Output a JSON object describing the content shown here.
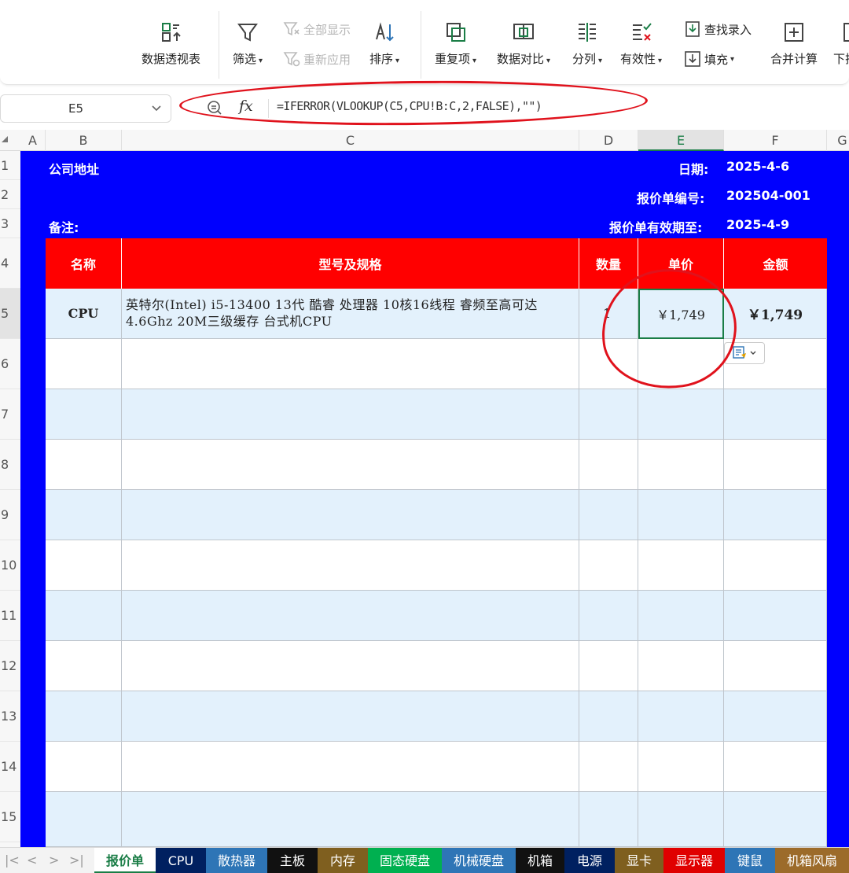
{
  "ribbon": {
    "pivot": "数据透视表",
    "filter": "筛选",
    "show_all": "全部显示",
    "reapply": "重新应用",
    "sort": "排序",
    "duplicates": "重复项",
    "compare": "数据对比",
    "split": "分列",
    "validity": "有效性",
    "find_entry": "查找录入",
    "fill": "填充",
    "consolidate": "合并计算",
    "next_partial": "下拉"
  },
  "formula_bar": {
    "cell_ref": "E5",
    "formula": "=IFERROR(VLOOKUP(C5,CPU!B:C,2,FALSE),\"\")"
  },
  "columns": [
    "A",
    "B",
    "C",
    "D",
    "E",
    "F",
    "G"
  ],
  "rows": [
    "1",
    "2",
    "3",
    "4",
    "5",
    "6",
    "7",
    "8",
    "9",
    "10",
    "11",
    "12",
    "13",
    "14",
    "15"
  ],
  "header_block": {
    "company": "公司地址",
    "date_label": "日期:",
    "date_value": "2025-4-6",
    "quote_no_label": "报价单编号:",
    "quote_no_value": "202504-001",
    "remark_label": "备注:",
    "valid_label": "报价单有效期至:",
    "valid_value": "2025-4-9"
  },
  "table": {
    "headers": [
      "名称",
      "型号及规格",
      "数量",
      "单价",
      "金额"
    ],
    "rows": [
      {
        "name": "CPU",
        "spec": "英特尔(Intel) i5-13400 13代 酷睿 处理器 10核16线程 睿频至高可达4.6Ghz 20M三级缓存 台式机CPU",
        "qty": "1",
        "price": "￥1,749",
        "amount": "￥1,749"
      }
    ]
  },
  "tabs": [
    {
      "label": "报价单",
      "color": "#ffffff"
    },
    {
      "label": "CPU",
      "color": "#002060"
    },
    {
      "label": "散热器",
      "color": "#2e75b6"
    },
    {
      "label": "主板",
      "color": "#111111"
    },
    {
      "label": "内存",
      "color": "#7f5f1f"
    },
    {
      "label": "固态硬盘",
      "color": "#00b050"
    },
    {
      "label": "机械硬盘",
      "color": "#2e75b6"
    },
    {
      "label": "机箱",
      "color": "#111111"
    },
    {
      "label": "电源",
      "color": "#002060"
    },
    {
      "label": "显卡",
      "color": "#7f5f1f"
    },
    {
      "label": "显示器",
      "color": "#e00000"
    },
    {
      "label": "键鼠",
      "color": "#2e75b6"
    },
    {
      "label": "机箱风扇",
      "color": "#9c6b2a"
    }
  ],
  "colors": {
    "sheet_bg": "#0000fe",
    "header_row": "#ff0000",
    "band": "#e3f1fc",
    "selection": "#1a7d46",
    "annotation": "#e0121c"
  }
}
